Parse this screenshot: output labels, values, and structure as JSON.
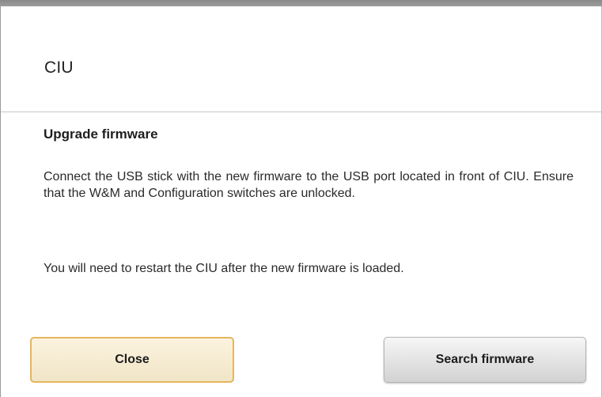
{
  "header": {
    "title": "CIU"
  },
  "dialog": {
    "title": "Upgrade firmware",
    "instructions": "Connect the USB stick with the new firmware to the USB port located in front of CIU. Ensure that the W&M and Configuration switches are unlocked.",
    "note": "You will need to restart the CIU after the new firmware is loaded."
  },
  "buttons": {
    "close_label": "Close",
    "search_label": "Search firmware"
  },
  "colors": {
    "close_border": "#e5b560",
    "close_fill": "#f6ecd2",
    "search_fill": "#e2e2e2",
    "top_bar": "#929292"
  }
}
